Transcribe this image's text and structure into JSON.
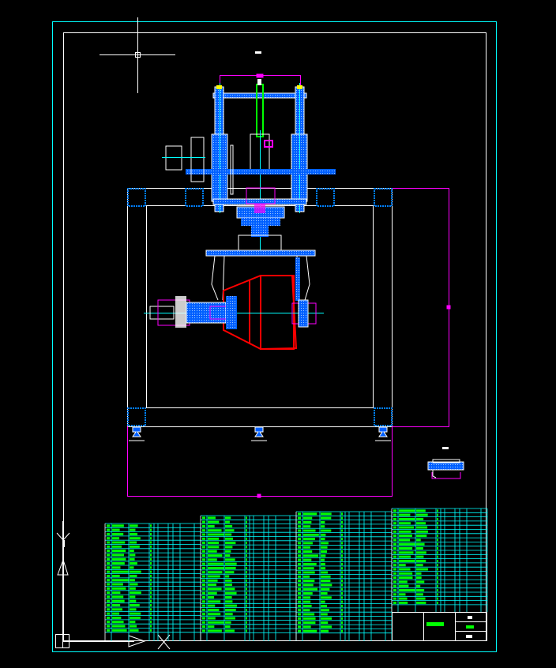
{
  "drawing": {
    "background": "#000000",
    "colors": {
      "border": "#00ffff",
      "frame": "#ffffff",
      "section": "#0080ff",
      "dimension": "#ff00ff",
      "cone": "#ff0000",
      "table_text": "#00ff00",
      "table_grid": "#00ffff",
      "highlight": "#ffff00"
    },
    "icons": [
      "crosshair-cursor-icon",
      "ucs-y-axis-icon",
      "ucs-x-axis-icon",
      "ucs-origin-icon"
    ]
  }
}
